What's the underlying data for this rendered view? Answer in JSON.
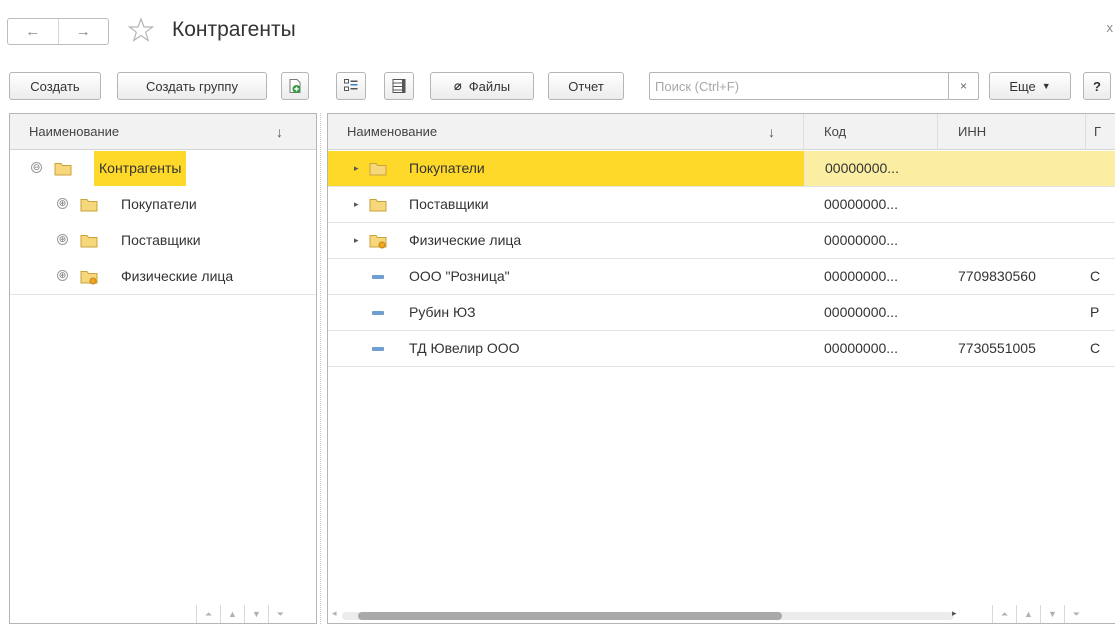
{
  "window": {
    "title": "Контрагенты",
    "back_glyph": "←",
    "forward_glyph": "→",
    "close_glyph": "x"
  },
  "toolbar": {
    "create_label": "Создать",
    "create_group_label": "Создать группу",
    "files_label": "Файлы",
    "report_label": "Отчет",
    "more_label": "Еще",
    "help_label": "?",
    "search": {
      "placeholder": "Поиск (Ctrl+F)",
      "value": "",
      "clear_glyph": "×"
    }
  },
  "tree_panel": {
    "header": "Наименование",
    "sort_glyph": "↓",
    "items": [
      {
        "label": "Контрагенты",
        "toggle": "⊖",
        "level": 0,
        "selected": true,
        "folder": "plain"
      },
      {
        "label": "Покупатели",
        "toggle": "⊕",
        "level": 1,
        "selected": false,
        "folder": "plain"
      },
      {
        "label": "Поставщики",
        "toggle": "⊕",
        "level": 1,
        "selected": false,
        "folder": "plain"
      },
      {
        "label": "Физические лица",
        "toggle": "⊕",
        "level": 1,
        "selected": false,
        "folder": "marked"
      }
    ]
  },
  "list_panel": {
    "columns": [
      {
        "label": "Наименование",
        "sort_glyph": "↓"
      },
      {
        "label": "Код"
      },
      {
        "label": "ИНН"
      },
      {
        "label": "Г"
      }
    ],
    "rows": [
      {
        "kind": "group",
        "expand": "▸",
        "folder": "plain",
        "name": "Покупатели",
        "code": "00000000...",
        "inn": "",
        "extra": "",
        "selected": true
      },
      {
        "kind": "group",
        "expand": "▸",
        "folder": "plain",
        "name": "Поставщики",
        "code": "00000000...",
        "inn": "",
        "extra": "",
        "selected": false
      },
      {
        "kind": "group",
        "expand": "▸",
        "folder": "marked",
        "name": "Физические лица",
        "code": "00000000...",
        "inn": "",
        "extra": "",
        "selected": false
      },
      {
        "kind": "element",
        "name": "ООО \"Розница\"",
        "code": "00000000...",
        "inn": "7709830560",
        "extra": "С",
        "selected": false
      },
      {
        "kind": "element",
        "name": "Рубин ЮЗ",
        "code": "00000000...",
        "inn": "",
        "extra": "Р",
        "selected": false
      },
      {
        "kind": "element",
        "name": "ТД Ювелир ООО",
        "code": "00000000...",
        "inn": "7730551005",
        "extra": "С",
        "selected": false
      }
    ]
  },
  "colors": {
    "selected_cell": "#ffd92a",
    "selected_row": "#fbeea3",
    "folder_fill": "#f7d77b",
    "folder_stroke": "#c9a23a",
    "element_marker": "#6e9fd0"
  }
}
